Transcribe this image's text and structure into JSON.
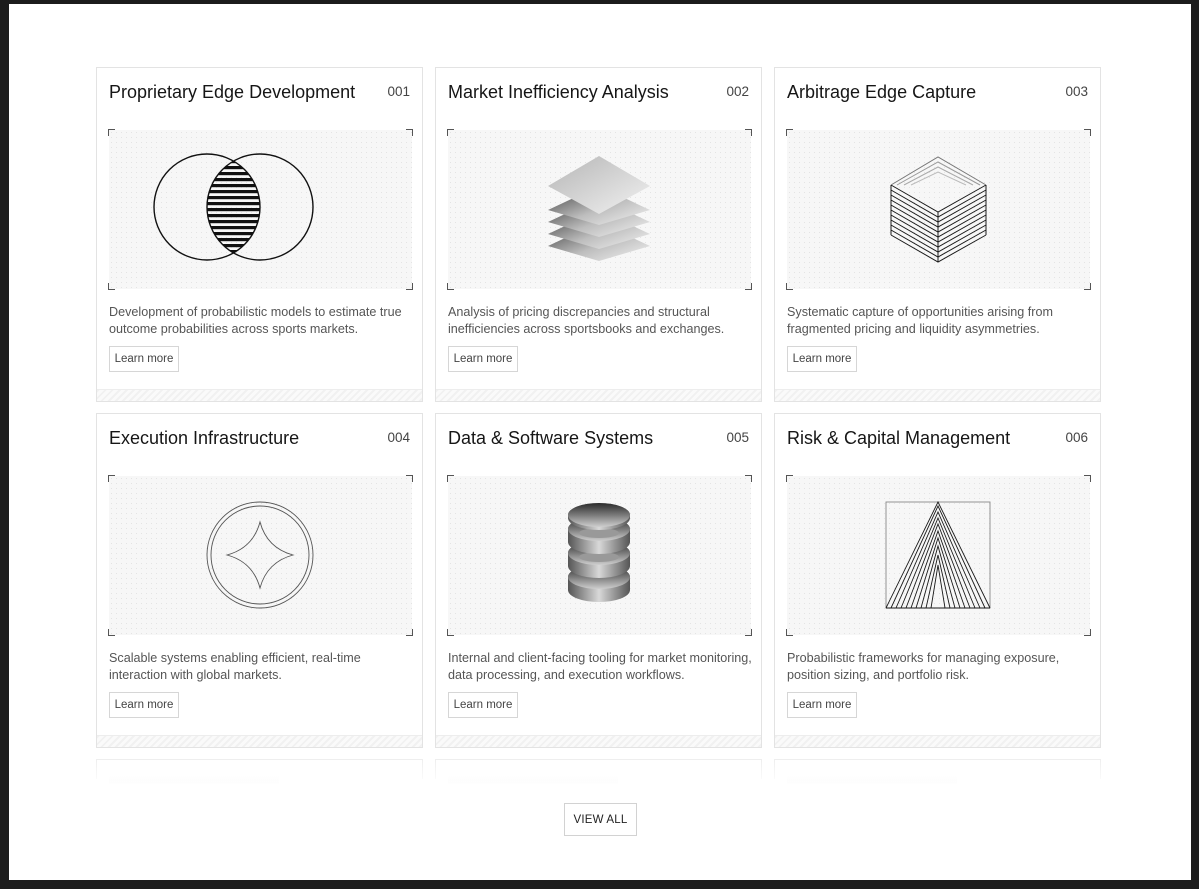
{
  "cards": [
    {
      "title": "Proprietary Edge Development",
      "number": "001",
      "illustration": "venn-intersection-icon",
      "description": "Development of probabilistic models to estimate true outcome probabilities across sports markets.",
      "button": "Learn more"
    },
    {
      "title": "Market Inefficiency Analysis",
      "number": "002",
      "illustration": "stacked-layers-icon",
      "description": "Analysis of pricing discrepancies and structural inefficiencies across sportsbooks and exchanges.",
      "button": "Learn more"
    },
    {
      "title": "Arbitrage Edge Capture",
      "number": "003",
      "illustration": "wireframe-cube-icon",
      "description": "Systematic capture of opportunities arising from fragmented pricing and liquidity asymmetries.",
      "button": "Learn more"
    },
    {
      "title": "Execution Infrastructure",
      "number": "004",
      "illustration": "star-in-circle-icon",
      "description": "Scalable systems enabling efficient, real-time interaction with global markets.",
      "button": "Learn more"
    },
    {
      "title": "Data & Software Systems",
      "number": "005",
      "illustration": "ring-stack-icon",
      "description": "Internal and client-facing tooling for market monitoring, data processing, and execution workflows.",
      "button": "Learn more"
    },
    {
      "title": "Risk & Capital Management",
      "number": "006",
      "illustration": "nested-triangles-icon",
      "description": "Probabilistic frameworks for managing exposure, position sizing, and portfolio risk.",
      "button": "Learn more"
    }
  ],
  "view_all": "VIEW ALL"
}
